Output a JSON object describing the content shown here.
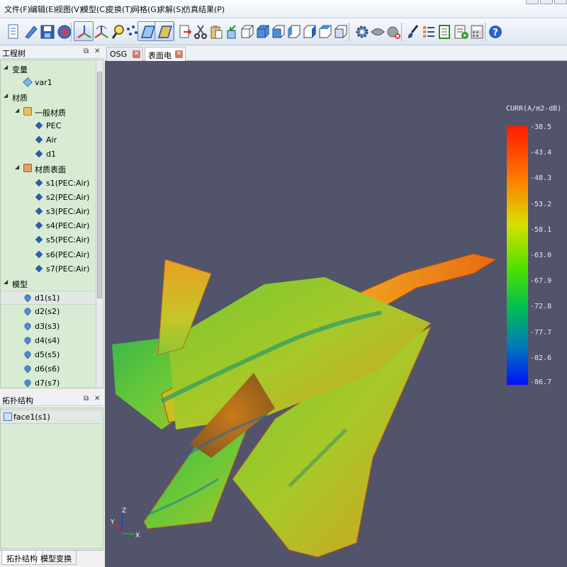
{
  "menu": [
    "文件(F)",
    "编辑(E)",
    "视图(V)",
    "模型(C)",
    "变换(T)",
    "网格(G)",
    "求解(S)",
    "仿真结果(P)"
  ],
  "toolbar": {
    "buttons": [
      "new-document",
      "edit-pencil",
      "save",
      "stop-record",
      "move-axes",
      "rotate-axes",
      "zoom-magnifier",
      "point-snap",
      "plane-select",
      "face-select",
      "export-document",
      "cut-scissors",
      "paste-clipboard",
      "import-arrow",
      "box-wire",
      "box-solid",
      "box-front",
      "box-left",
      "box-right",
      "box-top",
      "box-bottom",
      "settings-gear",
      "sphere-cloud",
      "remove-gear",
      "brush-tool",
      "list-properties",
      "report-sheet",
      "run-simulation",
      "calculator",
      "help-question"
    ]
  },
  "project_tree": {
    "title": "工程树",
    "items": [
      {
        "label": "变量",
        "level": 0,
        "arrow": "◢"
      },
      {
        "label": "var1",
        "level": 1,
        "icon": "variable-cube-icon"
      },
      {
        "label": "材质",
        "level": 0,
        "arrow": "◢"
      },
      {
        "label": "一般材质",
        "level": 1,
        "arrow": "◢",
        "icon": "material-folder-icon"
      },
      {
        "label": "PEC",
        "level": 2,
        "icon": "material-icon"
      },
      {
        "label": "Air",
        "level": 2,
        "icon": "material-icon"
      },
      {
        "label": "d1",
        "level": 2,
        "icon": "material-icon"
      },
      {
        "label": "材质表面",
        "level": 1,
        "arrow": "◢",
        "icon": "surface-folder-icon"
      },
      {
        "label": "s1(PEC:Air)",
        "level": 2,
        "icon": "material-icon"
      },
      {
        "label": "s2(PEC:Air)",
        "level": 2,
        "icon": "material-icon"
      },
      {
        "label": "s3(PEC:Air)",
        "level": 2,
        "icon": "material-icon"
      },
      {
        "label": "s4(PEC:Air)",
        "level": 2,
        "icon": "material-icon"
      },
      {
        "label": "s5(PEC:Air)",
        "level": 2,
        "icon": "material-icon"
      },
      {
        "label": "s6(PEC:Air)",
        "level": 2,
        "icon": "material-icon"
      },
      {
        "label": "s7(PEC:Air)",
        "level": 2,
        "icon": "material-icon"
      },
      {
        "label": "模型",
        "level": 0,
        "arrow": "◢"
      },
      {
        "label": "d1(s1)",
        "level": 1,
        "icon": "model-icon",
        "selected": true
      },
      {
        "label": "d2(s2)",
        "level": 1,
        "icon": "model-icon"
      },
      {
        "label": "d3(s3)",
        "level": 1,
        "icon": "model-icon"
      },
      {
        "label": "d4(s4)",
        "level": 1,
        "icon": "model-icon"
      },
      {
        "label": "d5(s5)",
        "level": 1,
        "icon": "model-icon"
      },
      {
        "label": "d6(s6)",
        "level": 1,
        "icon": "model-icon"
      },
      {
        "label": "d7(s7)",
        "level": 1,
        "icon": "model-icon"
      }
    ]
  },
  "topology": {
    "title": "拓扑结构",
    "items": [
      {
        "label": "face1(s1)",
        "icon": "face-icon"
      }
    ]
  },
  "bottom_tabs": [
    "拓扑结构",
    "模型变换"
  ],
  "view_tabs": [
    {
      "label": "OSG窗口",
      "active": false
    },
    {
      "label": "表面电流",
      "active": true
    }
  ],
  "colorbar": {
    "title": "CURR(A/m2-dB)",
    "ticks": [
      "-38.5",
      "-43.4",
      "-48.3",
      "-53.2",
      "-58.1",
      "-63.0",
      "-67.9",
      "-72.8",
      "-77.7",
      "-82.6",
      "-86.7"
    ]
  },
  "axes": {
    "z": "Z",
    "y": "Y",
    "x": "X"
  },
  "colors": {
    "viewport_bg": "#51546a",
    "tree_bg": "#d8ecd3"
  }
}
